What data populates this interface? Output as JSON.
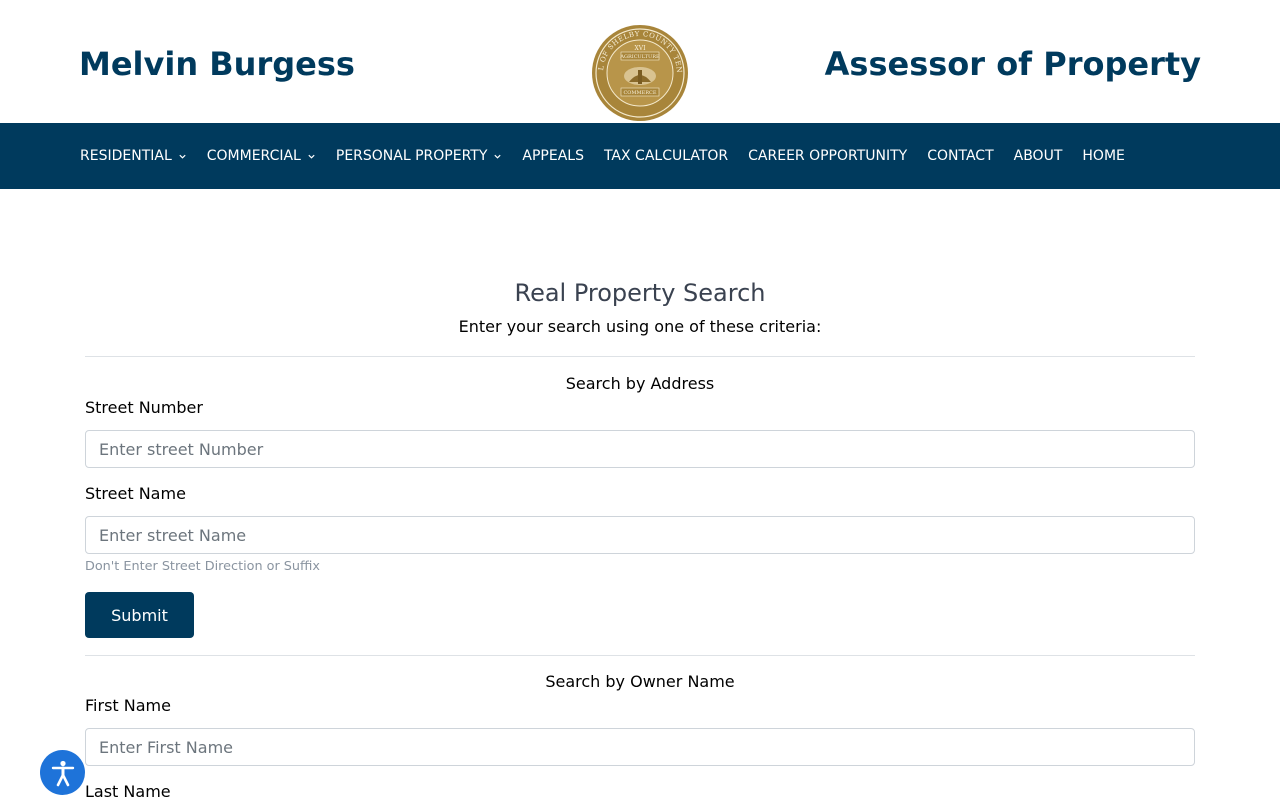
{
  "header": {
    "left_title": "Melvin Burgess",
    "right_title": "Assessor of Property",
    "seal_text_top": "THE SEAL OF SHELBY COUNTY TENNESSEE",
    "seal_text_mid": "AGRICULTURE",
    "seal_text_bottom": "COMMERCE",
    "seal_numeral": "XVI"
  },
  "nav": {
    "items": [
      {
        "label": "RESIDENTIAL",
        "dropdown": true
      },
      {
        "label": "COMMERCIAL",
        "dropdown": true
      },
      {
        "label": "PERSONAL PROPERTY",
        "dropdown": true
      },
      {
        "label": "APPEALS",
        "dropdown": false
      },
      {
        "label": "TAX CALCULATOR",
        "dropdown": false
      },
      {
        "label": "CAREER OPPORTUNITY",
        "dropdown": false
      },
      {
        "label": "CONTACT",
        "dropdown": false
      },
      {
        "label": "ABOUT",
        "dropdown": false
      },
      {
        "label": "HOME",
        "dropdown": false
      }
    ]
  },
  "search": {
    "title": "Real Property Search",
    "subtitle": "Enter your search using one of these criteria:",
    "address_section": {
      "title": "Search by Address",
      "street_number_label": "Street Number",
      "street_number_placeholder": "Enter street Number",
      "street_number_value": "",
      "street_name_label": "Street Name",
      "street_name_placeholder": "Enter street Name",
      "street_name_value": "",
      "hint": "Don't Enter Street Direction or Suffix",
      "submit_label": "Submit"
    },
    "owner_section": {
      "title": "Search by Owner Name",
      "first_name_label": "First Name",
      "first_name_placeholder": "Enter First Name",
      "first_name_value": "",
      "last_name_label": "Last Name"
    }
  },
  "colors": {
    "brand": "#003a5d",
    "seal_gold": "#a8853a",
    "accessibility": "#1e73d9"
  },
  "icons": {
    "seal": "shelby-county-seal-icon",
    "chevron": "chevron-down-icon",
    "accessibility": "accessibility-icon"
  }
}
